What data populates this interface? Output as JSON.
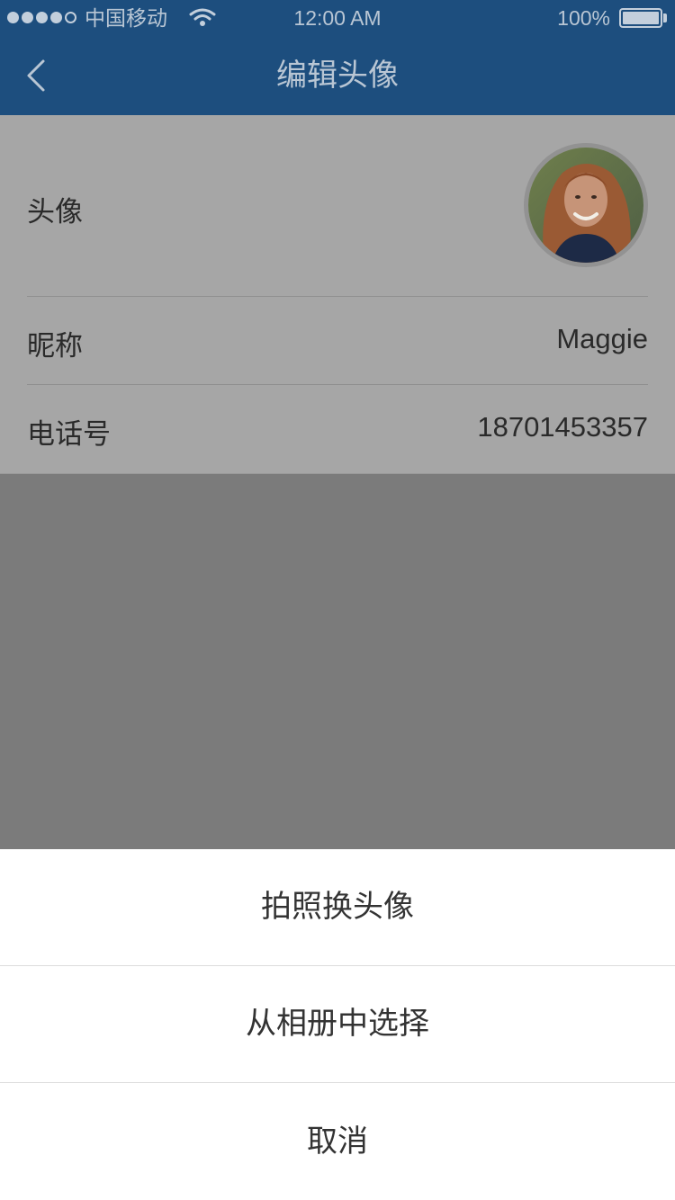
{
  "status_bar": {
    "carrier": "中国移动",
    "time": "12:00 AM",
    "battery": "100%",
    "signal_bars_filled": 4,
    "signal_bars_total": 5
  },
  "nav": {
    "title": "编辑头像",
    "back_icon": "chevron-left-icon"
  },
  "profile": {
    "avatar_label": "头像",
    "nickname_label": "昵称",
    "nickname_value": "Maggie",
    "phone_label": "电话号",
    "phone_value": "18701453357"
  },
  "action_sheet": {
    "take_photo": "拍照换头像",
    "choose_album": "从相册中选择",
    "cancel": "取消"
  },
  "colors": {
    "nav_bg": "#1d4e7e",
    "overlay": "#7b7b7b",
    "sheet_bg": "#ffffff"
  }
}
